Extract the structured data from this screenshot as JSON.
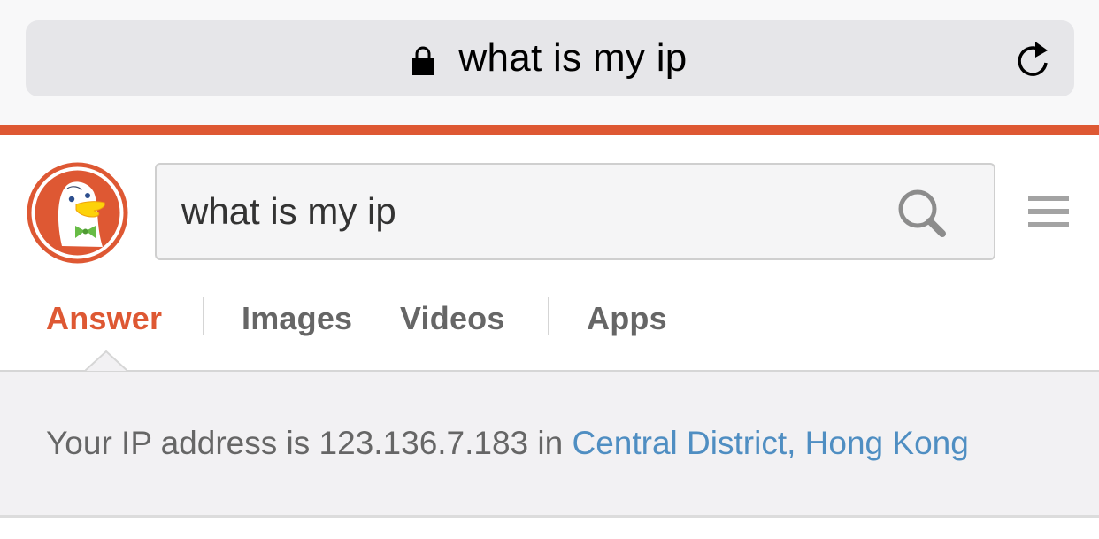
{
  "browser": {
    "url_text": "what is my ip",
    "lock_icon": "lock-icon",
    "reload_icon": "reload-icon",
    "accent_color": "#de5833"
  },
  "header": {
    "logo": "duckduckgo-logo",
    "search": {
      "value": "what is my ip",
      "icon": "search-icon"
    },
    "menu_icon": "hamburger-menu-icon"
  },
  "tabs": [
    {
      "label": "Answer",
      "active": true
    },
    {
      "label": "Images",
      "active": false
    },
    {
      "label": "Videos",
      "active": false
    },
    {
      "label": "Apps",
      "active": false
    }
  ],
  "answer": {
    "prefix": "Your IP address is 123.136.7.183 in ",
    "location": "Central District, Hong Kong",
    "link_color": "#4f8ec2"
  }
}
